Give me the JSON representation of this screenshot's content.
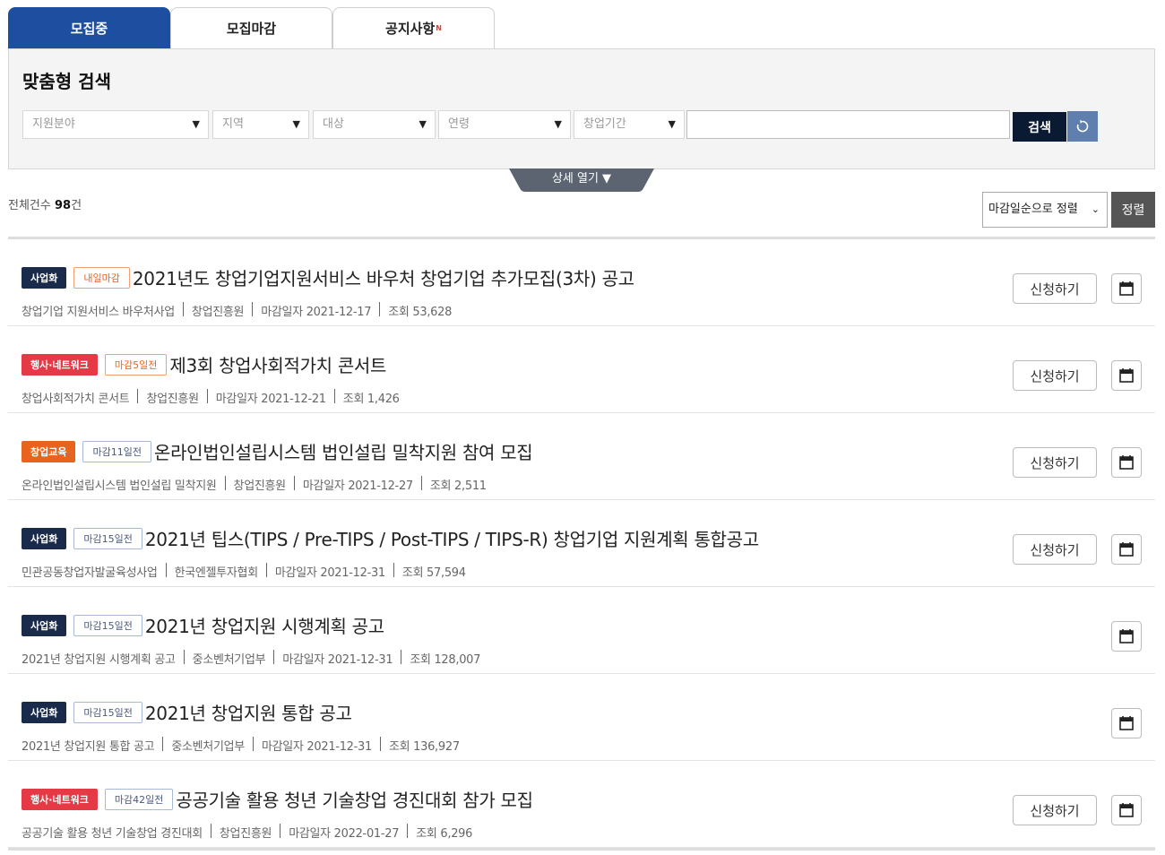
{
  "tabs": [
    {
      "label": "모집중",
      "active": true
    },
    {
      "label": "모집마감",
      "active": false
    },
    {
      "label": "공지사항",
      "badge": "N",
      "active": false
    }
  ],
  "search": {
    "title": "맞춤형 검색",
    "filters": [
      "지원분야",
      "지역",
      "대상",
      "연령",
      "창업기간"
    ],
    "input_value": "",
    "button_label": "검색",
    "detail_toggle": "상세 열기 ▼"
  },
  "summary": {
    "prefix": "전체건수",
    "count": "98",
    "suffix": "건"
  },
  "sort": {
    "selected": "마감일순으로 정렬",
    "button_label": "정렬"
  },
  "colors": {
    "tab_active": "#1e4ea0",
    "search_btn": "#0b1a33",
    "reset_btn": "#5f7fae",
    "cat_navy": "#1a2a4a",
    "cat_red": "#e53946",
    "cat_orange": "#e8631c"
  },
  "items": [
    {
      "category": "사업화",
      "category_color": "navy",
      "dday": "내일마감",
      "dday_style": "orange",
      "title": "2021년도 창업기업지원서비스 바우처 창업기업 추가모집(3차) 공고",
      "meta": [
        "창업기업 지원서비스 바우처사업",
        "창업진흥원",
        "마감일자 2021-12-17",
        "조회 53,628"
      ],
      "apply_label": "신청하기"
    },
    {
      "category": "행사·네트워크",
      "category_color": "red",
      "dday": "마감5일전",
      "dday_style": "orange",
      "title": "제3회 창업사회적가치 콘서트",
      "meta": [
        "창업사회적가치 콘서트",
        "창업진흥원",
        "마감일자 2021-12-21",
        "조회 1,426"
      ],
      "apply_label": "신청하기"
    },
    {
      "category": "창업교육",
      "category_color": "orange",
      "dday": "마감11일전",
      "dday_style": "blue",
      "title": "온라인법인설립시스템 법인설립 밀착지원 참여 모집",
      "meta": [
        "온라인법인설립시스템 법인설립 밀착지원",
        "창업진흥원",
        "마감일자 2021-12-27",
        "조회 2,511"
      ],
      "apply_label": "신청하기"
    },
    {
      "category": "사업화",
      "category_color": "navy",
      "dday": "마감15일전",
      "dday_style": "blue",
      "title": "2021년 팁스(TIPS / Pre-TIPS / Post-TIPS / TIPS-R) 창업기업 지원계획 통합공고",
      "meta": [
        "민관공동창업자발굴육성사업",
        "한국엔젤투자협회",
        "마감일자 2021-12-31",
        "조회 57,594"
      ],
      "apply_label": "신청하기"
    },
    {
      "category": "사업화",
      "category_color": "navy",
      "dday": "마감15일전",
      "dday_style": "blue",
      "title": "2021년 창업지원 시행계획 공고",
      "meta": [
        "2021년 창업지원 시행계획 공고",
        "중소벤처기업부",
        "마감일자 2021-12-31",
        "조회 128,007"
      ],
      "apply_label": ""
    },
    {
      "category": "사업화",
      "category_color": "navy",
      "dday": "마감15일전",
      "dday_style": "blue",
      "title": "2021년 창업지원 통합 공고",
      "meta": [
        "2021년 창업지원 통합 공고",
        "중소벤처기업부",
        "마감일자 2021-12-31",
        "조회 136,927"
      ],
      "apply_label": ""
    },
    {
      "category": "행사·네트워크",
      "category_color": "red",
      "dday": "마감42일전",
      "dday_style": "blue",
      "title": "공공기술 활용 청년 기술창업 경진대회 참가 모집",
      "meta": [
        "공공기술 활용 청년 기술창업 경진대회",
        "창업진흥원",
        "마감일자 2022-01-27",
        "조회 6,296"
      ],
      "apply_label": "신청하기"
    }
  ]
}
